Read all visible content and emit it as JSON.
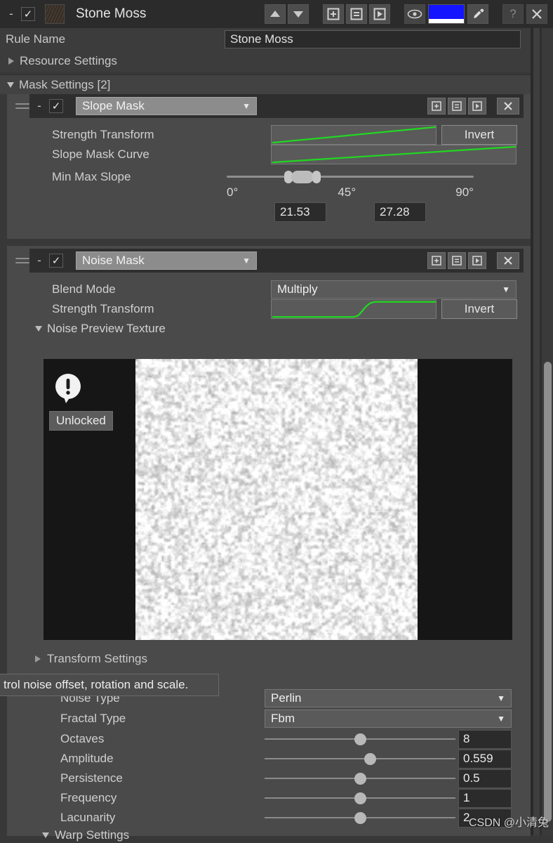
{
  "titlebar": {
    "collapse_label": "-",
    "title": "Stone Moss",
    "icons": {
      "move_up": "arrow-up-icon",
      "move_down": "arrow-down-icon",
      "add": "add-icon",
      "duplicate": "duplicate-icon",
      "play": "play-icon",
      "visibility": "eye-icon",
      "eyedropper": "eyedropper-icon",
      "help": "?",
      "close": "X"
    },
    "color_swatch": "#1414ff",
    "color_alpha": "#ffffff"
  },
  "rule_name": {
    "label": "Rule Name",
    "value": "Stone Moss"
  },
  "sections": {
    "resource_settings": "Resource Settings",
    "mask_settings": "Mask Settings [2]",
    "transform_settings": "Transform Settings",
    "warp_settings": "Warp Settings"
  },
  "slope_mask": {
    "dash": "-",
    "type": "Slope Mask",
    "enabled": true,
    "strength_transform_label": "Strength Transform",
    "strength_invert_label": "Invert",
    "slope_curve_label": "Slope Mask Curve",
    "min_max_label": "Min Max Slope",
    "ticks": [
      "0°",
      "45°",
      "90°"
    ],
    "min_value": "21.53",
    "max_value": "27.28"
  },
  "noise_mask": {
    "dash": "-",
    "type": "Noise Mask",
    "enabled": true,
    "blend_mode_label": "Blend Mode",
    "blend_mode_value": "Multiply",
    "strength_transform_label": "Strength Transform",
    "strength_invert_label": "Invert",
    "preview_label": "Noise Preview Texture",
    "preview_badge": "Unlocked",
    "preview_warning_icon": "warning-bubble-icon"
  },
  "tooltip": {
    "text": "trol noise offset, rotation and scale."
  },
  "noise_params": {
    "noise_type_label": "Noise Type",
    "noise_type_value": "Perlin",
    "fractal_type_label": "Fractal Type",
    "fractal_type_value": "Fbm",
    "sliders": [
      {
        "label": "Octaves",
        "value": "8",
        "pct": 50
      },
      {
        "label": "Amplitude",
        "value": "0.559",
        "pct": 55
      },
      {
        "label": "Persistence",
        "value": "0.5",
        "pct": 50
      },
      {
        "label": "Frequency",
        "value": "1",
        "pct": 50
      },
      {
        "label": "Lacunarity",
        "value": "2",
        "pct": 50
      }
    ]
  },
  "watermark": "CSDN @小清兔"
}
